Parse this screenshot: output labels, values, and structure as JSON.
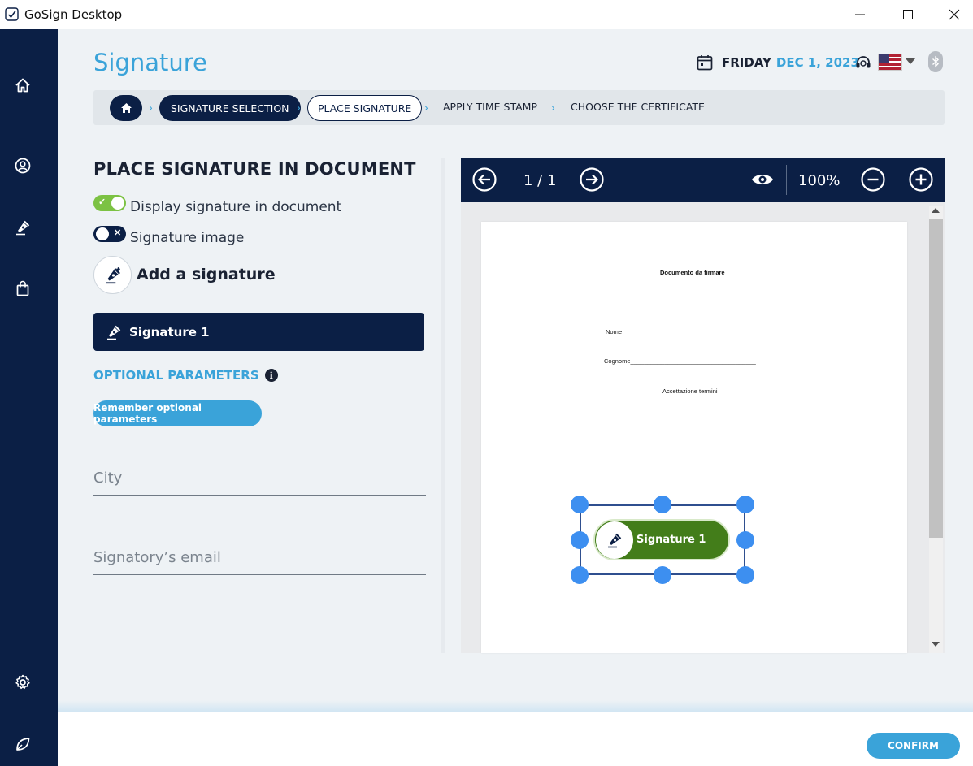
{
  "window": {
    "title": "GoSign Desktop"
  },
  "header": {
    "page_title": "Signature",
    "day": "FRIDAY",
    "date": "DEC 1, 2023"
  },
  "breadcrumb": {
    "steps": [
      {
        "label": "SIGNATURE SELECTION",
        "state": "completed"
      },
      {
        "label": "PLACE SIGNATURE",
        "state": "current"
      },
      {
        "label": "APPLY TIME STAMP",
        "state": "pending"
      },
      {
        "label": "CHOOSE THE CERTIFICATE",
        "state": "pending"
      }
    ]
  },
  "left_panel": {
    "heading": "PLACE SIGNATURE IN DOCUMENT",
    "toggles": [
      {
        "label": "Display signature in document",
        "on": true
      },
      {
        "label": "Signature image",
        "on": false
      }
    ],
    "add_signature_label": "Add a signature",
    "signatures": [
      {
        "label": "Signature 1"
      }
    ],
    "optional_parameters_label": "OPTIONAL PARAMETERS",
    "remember_button": "Remember optional parameters",
    "fields": [
      {
        "placeholder": "City",
        "value": ""
      },
      {
        "placeholder": "Signatory’s email",
        "value": ""
      }
    ]
  },
  "viewer": {
    "page_indicator": "1 / 1",
    "zoom": "100%",
    "document": {
      "title": "Documento da firmare",
      "lines": [
        "Nome________________________________________",
        "Cognome_____________________________________",
        "Accettazione termini"
      ]
    },
    "placed_signature_label": "Signature 1"
  },
  "footer": {
    "confirm_label": "CONFIRM"
  },
  "colors": {
    "navy": "#0b1f45",
    "accent_blue": "#3aa3d9",
    "toggle_on": "#7cc243",
    "signature_green": "#437d1a",
    "handle_blue": "#3d8ff0"
  }
}
